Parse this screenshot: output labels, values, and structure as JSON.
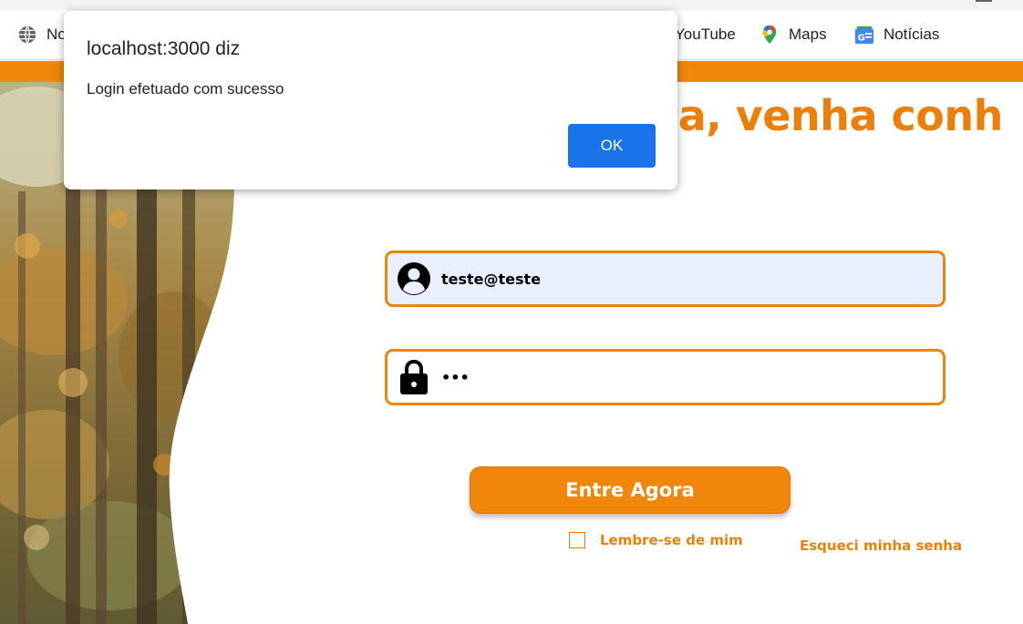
{
  "browser": {
    "bookmarks": [
      {
        "label": "No",
        "icon": "globe-icon"
      },
      {
        "label": "YouTube",
        "icon": "youtube-icon"
      },
      {
        "label": "Maps",
        "icon": "maps-pin-icon"
      },
      {
        "label": "Notícias",
        "icon": "news-icon"
      }
    ]
  },
  "page": {
    "heading": "nta, venha conh",
    "email_value": "teste@teste",
    "password_value": "•••",
    "login_button": "Entre Agora",
    "remember_label": "Lembre-se de mim",
    "forgot_label": "Esqueci minha senha"
  },
  "dialog": {
    "title": "localhost:3000 diz",
    "message": "Login efetuado com sucesso",
    "ok_label": "OK"
  },
  "colors": {
    "accent": "#f0860c",
    "autofill": "#e8f0fe",
    "dialog_button": "#1a73e8"
  }
}
